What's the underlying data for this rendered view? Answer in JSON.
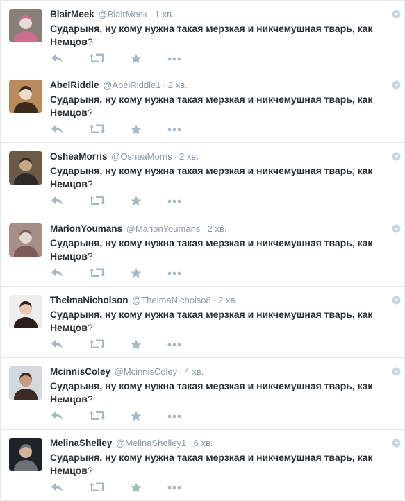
{
  "tweets": [
    {
      "name": "BlairMeek",
      "handle": "@BlairMeek",
      "time": "1 хв.",
      "text": "Сударыня, ну кому нужна такая мерзкая и никчемушная тварь, как Немцов",
      "text_tail": "?",
      "avatar_colors": [
        "#8a7f78",
        "#e7dcd8",
        "#cc6f8f"
      ]
    },
    {
      "name": "AbelRiddle",
      "handle": "@AbelRiddle1",
      "time": "2 хв.",
      "text": "Сударыня, ну кому нужна такая мерзкая и никчемушная тварь, как Немцов",
      "text_tail": "?",
      "avatar_colors": [
        "#b98a5a",
        "#e9dcc9",
        "#3d2a1f"
      ]
    },
    {
      "name": "OsheaMorris",
      "handle": "@OsheaMorris",
      "time": "2 хв.",
      "text": "Сударыня, ну кому нужна такая мерзкая и никчемушная тварь, как Немцов",
      "text_tail": "?",
      "avatar_colors": [
        "#6b5a48",
        "#c9a887",
        "#2f2a26"
      ]
    },
    {
      "name": "MarionYoumans",
      "handle": "@MarionYoumans",
      "time": "2 хв.",
      "text": "Сударыня, ну кому нужна такая мерзкая и никчемушная тварь, как Немцов",
      "text_tail": "?",
      "avatar_colors": [
        "#a78f86",
        "#e6d7d2",
        "#7d5b56"
      ]
    },
    {
      "name": "ThelmaNicholson",
      "handle": "@ThelmaNicholso8",
      "time": "2 хв.",
      "text": "Сударыня, ну кому нужна такая мерзкая и никчемушная тварь, как Немцов",
      "text_tail": "?",
      "avatar_colors": [
        "#f1eeee",
        "#e7c7b5",
        "#2a1e1c"
      ]
    },
    {
      "name": "McinnisColey",
      "handle": "@McinnisColey",
      "time": "4 хв.",
      "text": "Сударыня, ну кому нужна такая мерзкая и никчемушная тварь, как Немцов",
      "text_tail": "?",
      "avatar_colors": [
        "#d4d9dd",
        "#c69a7e",
        "#3b2b24"
      ]
    },
    {
      "name": "MelinaShelley",
      "handle": "@MelinaShelley1",
      "time": "6 хв.",
      "text": "Сударыня, ну кому нужна такая мерзкая и никчемушная тварь, как Немцов",
      "text_tail": "?",
      "avatar_colors": [
        "#1f2328",
        "#d0b39e",
        "#6c6f75"
      ]
    }
  ],
  "icons": {
    "reply": "reply-icon",
    "retweet": "retweet-icon",
    "favorite": "star-icon",
    "more": "more-icon",
    "caret": "dropdown-caret-icon"
  },
  "colors": {
    "name": "#292f33",
    "meta": "#8899a6",
    "action_icon": "#aab8c2",
    "border": "#e1e8ed"
  }
}
